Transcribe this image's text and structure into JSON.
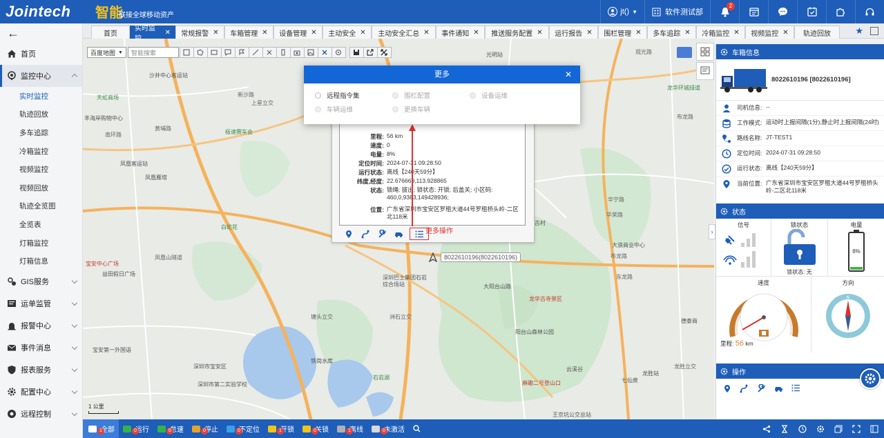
{
  "header": {
    "logo": "Jointech",
    "slogan_big": "智能",
    "slogan": "联接全球移动资产",
    "user": "jt()",
    "company": "软件测试部",
    "notif_count": "2"
  },
  "sidebar": {
    "items": [
      {
        "label": "首页"
      },
      {
        "label": "监控中心"
      },
      {
        "label": "GIS服务"
      },
      {
        "label": "运单监管"
      },
      {
        "label": "报警中心"
      },
      {
        "label": "事件消息"
      },
      {
        "label": "报表服务"
      },
      {
        "label": "配置中心"
      },
      {
        "label": "远程控制"
      }
    ],
    "subitems": [
      "实时监控",
      "轨迹回放",
      "多车追踪",
      "冷箱监控",
      "视频监控",
      "视频回放",
      "轨迹全览图",
      "全览表",
      "灯箱监控",
      "灯箱信息"
    ]
  },
  "tabs": [
    "首页",
    "实时监控",
    "常规报警",
    "车箱管理",
    "设备管理",
    "主动安全",
    "主动安全汇总",
    "事件通知",
    "推送服务配置",
    "运行报告",
    "围栏管理",
    "多车追踪",
    "冷箱监控",
    "视频监控",
    "轨迹回放"
  ],
  "map": {
    "map_type": "百度地图",
    "search_placeholder": "智能搜索",
    "scale": "1 公里",
    "labels": {
      "a": "天虹商场",
      "b": "沙井中心客运站",
      "c": "丰海岸购物中心",
      "d": "南环路",
      "e": "黄埔路",
      "f": "凤凰客运站",
      "g": "凤凰雁塔",
      "h": "凤凰山隧道",
      "i": "宝安中心广场",
      "j": "益田假日广场",
      "k": "宝安第一外国语",
      "l": "深圳市宝安区",
      "m": "白蛇花",
      "n": "新沙路",
      "o": "上星立交",
      "p": "极速赛车会",
      "q": "光明站",
      "r": "观光路",
      "s": "龙华环城绿道",
      "t": "布龙路",
      "u": "水晶古村",
      "v": "大浪商业中心",
      "w": "华荣路",
      "x": "布龙路",
      "y": "大阳台山路",
      "z": "深圳巴士集团石岩综合场站",
      "aa": "龙华古寺景区",
      "ab": "阳台山森林公园",
      "ac": "麻磡二号登山口",
      "ad": "王京坑公交总站",
      "ae": "七仙泉",
      "af": "华宁路",
      "ag": "东龙路",
      "ah": "龙胜站",
      "ai": "龙胜立交",
      "aj": "德泰商",
      "ak": "塘头立交",
      "al": "洲石立交",
      "am": "深圳市第二实验学校",
      "an": "石岩湖",
      "ao": "铁岗水库",
      "ap": "云溪谷"
    }
  },
  "popup": {
    "rows": [
      {
        "k": "里程:",
        "v": "56 km"
      },
      {
        "k": "速度:",
        "v": "0"
      },
      {
        "k": "电量:",
        "v": "8%"
      },
      {
        "k": "定位时间:",
        "v": "2024-07-31 09:28:50"
      },
      {
        "k": "运行状态:",
        "v": "离线【240天59分】"
      },
      {
        "k": "纬度,经度:",
        "v": "22.676669,113.928865"
      },
      {
        "k": "状态:",
        "v": "锁绳: 拔出; 锁状态: 开锁; 后盖关; 小区码: 460,0,9383,149428936;"
      },
      {
        "k": "位置:",
        "v": "广东省深圳市宝安区罗租大道44号罗租桥头岭-二区北118米"
      }
    ],
    "more_note": "更多操作",
    "vehicle_label": "8022610196(8022610196)"
  },
  "modal": {
    "title": "更多",
    "options": [
      {
        "label": "远程指令集",
        "enabled": true
      },
      {
        "label": "围栏配置",
        "enabled": false
      },
      {
        "label": "设备运维",
        "enabled": false
      },
      {
        "label": "车辆运维",
        "enabled": false
      },
      {
        "label": "更换车辆",
        "enabled": false
      }
    ]
  },
  "statusbar": [
    {
      "label": "全部",
      "count": "1",
      "color": "#ffffff"
    },
    {
      "label": "运行",
      "count": "0",
      "color": "#35b34a"
    },
    {
      "label": "怠速",
      "count": "0",
      "color": "#35b34a"
    },
    {
      "label": "停止",
      "count": "0",
      "color": "#e7a12c"
    },
    {
      "label": "不定位",
      "count": "0",
      "color": "#3aa0e8"
    },
    {
      "label": "开锁",
      "count": "1",
      "color": "#f0c419"
    },
    {
      "label": "关锁",
      "count": "0",
      "color": "#f0c419"
    },
    {
      "label": "离线",
      "count": "1",
      "color": "#b0b0b0"
    },
    {
      "label": "未激活",
      "count": "0",
      "color": "#d9d9d9"
    }
  ],
  "rpanel": {
    "vehicle_head": "车箱信息",
    "vehicle_title": "8022610196 [8022610196]",
    "info": [
      {
        "k": "司机信息:",
        "v": "--"
      },
      {
        "k": "工作模式:",
        "v": "运动时上报间隔(1分);静止时上报间隔(24时)"
      },
      {
        "k": "路线名称:",
        "v": "JT-TEST1"
      },
      {
        "k": "定位时间:",
        "v": "2024-07-31 09:28:50"
      },
      {
        "k": "运行状态:",
        "v": "离线【240天59分】"
      },
      {
        "k": "当前位置:",
        "v": "广东省深圳市宝安区罗租大道44号罗租桥头岭-二区北118米"
      }
    ],
    "status_head": "状态",
    "signal": "信号",
    "lock_status": "锁状态",
    "lock_value": "锁状态: 无",
    "battery": "电量",
    "battery_value": "8%",
    "battery_level": 0.08,
    "speed": "速度",
    "direction": "方向",
    "mileage_label": "里程:",
    "mileage_value": "56",
    "mileage_unit": "km",
    "ops_head": "操作"
  },
  "colors": {
    "primary": "#1e5db8",
    "modal": "#1366d6",
    "accent": "#e5832a",
    "alert": "#e03030"
  }
}
